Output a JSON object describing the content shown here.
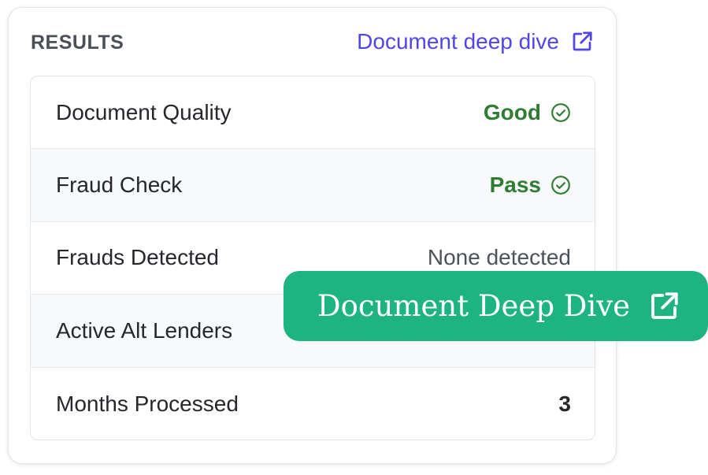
{
  "header": {
    "title": "RESULTS",
    "link_label": "Document deep dive",
    "link_icon": "external-link-icon",
    "link_color": "#5046e5"
  },
  "rows": [
    {
      "label": "Document Quality",
      "value": "Good",
      "status": "ok",
      "icon": "check-circle-icon"
    },
    {
      "label": "Fraud Check",
      "value": "Pass",
      "status": "ok",
      "icon": "check-circle-icon"
    },
    {
      "label": "Frauds Detected",
      "value": "None detected",
      "status": "neutral"
    },
    {
      "label": "Active Alt Lenders",
      "value": "",
      "status": "neutral"
    },
    {
      "label": "Months Processed",
      "value": "3",
      "status": "number"
    }
  ],
  "overlay_button": {
    "label": "Document Deep Dive",
    "icon": "external-link-icon",
    "color": "#1eb482"
  },
  "colors": {
    "success": "#2f7d32",
    "accent": "#5046e5"
  }
}
